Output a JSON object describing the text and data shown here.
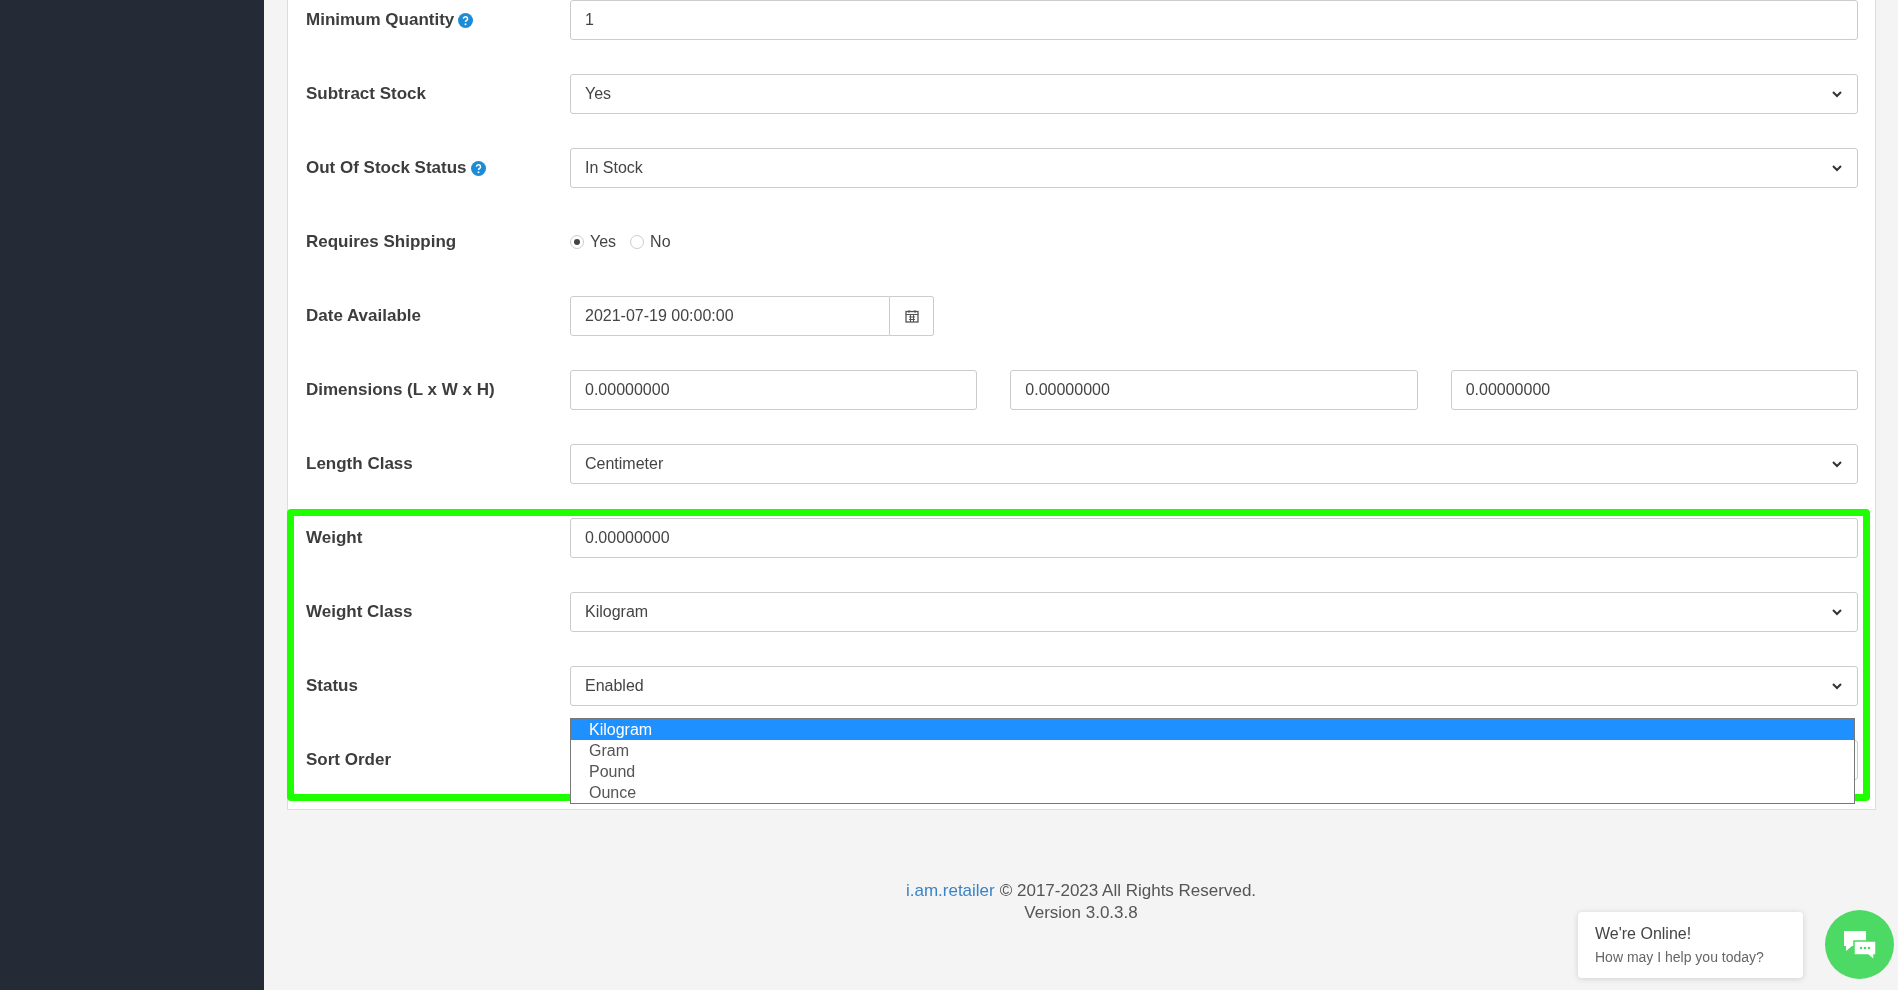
{
  "fields": [
    {
      "kind": "text",
      "label": "Minimum Quantity",
      "help": true,
      "value": "1"
    },
    {
      "kind": "select",
      "label": "Subtract Stock",
      "help": false,
      "value": "Yes"
    },
    {
      "kind": "select",
      "label": "Out Of Stock Status",
      "help": true,
      "value": "In Stock"
    },
    {
      "kind": "radio",
      "label": "Requires Shipping",
      "help": false,
      "options": [
        {
          "label": "Yes",
          "selected": true
        },
        {
          "label": "No",
          "selected": false
        }
      ]
    },
    {
      "kind": "date",
      "label": "Date Available",
      "help": false,
      "value": "2021-07-19 00:00:00"
    },
    {
      "kind": "triple",
      "label": "Dimensions (L x W x H)",
      "help": false,
      "values": [
        "0.00000000",
        "0.00000000",
        "0.00000000"
      ]
    },
    {
      "kind": "select",
      "label": "Length Class",
      "help": false,
      "value": "Centimeter"
    }
  ],
  "highlighted_fields": [
    {
      "kind": "text",
      "label": "Weight",
      "help": false,
      "value": "0.00000000"
    },
    {
      "kind": "select",
      "label": "Weight Class",
      "help": false,
      "value": "Kilogram"
    },
    {
      "kind": "select",
      "label": "Status",
      "help": false,
      "value": "Enabled"
    },
    {
      "kind": "text",
      "label": "Sort Order",
      "help": false
    }
  ],
  "dropdown_list": {
    "options": [
      {
        "label": "Kilogram",
        "selected": true
      },
      {
        "label": "Gram",
        "selected": false
      },
      {
        "label": "Pound",
        "selected": false
      },
      {
        "label": "Ounce",
        "selected": false
      }
    ]
  },
  "footer": {
    "link": "i.am.retailer",
    "copyright": "© 2017-2023 All Rights Reserved.",
    "version": "Version 3.0.3.8"
  },
  "chat": {
    "title": "We're Online!",
    "subtitle": "How may I help you today?"
  }
}
